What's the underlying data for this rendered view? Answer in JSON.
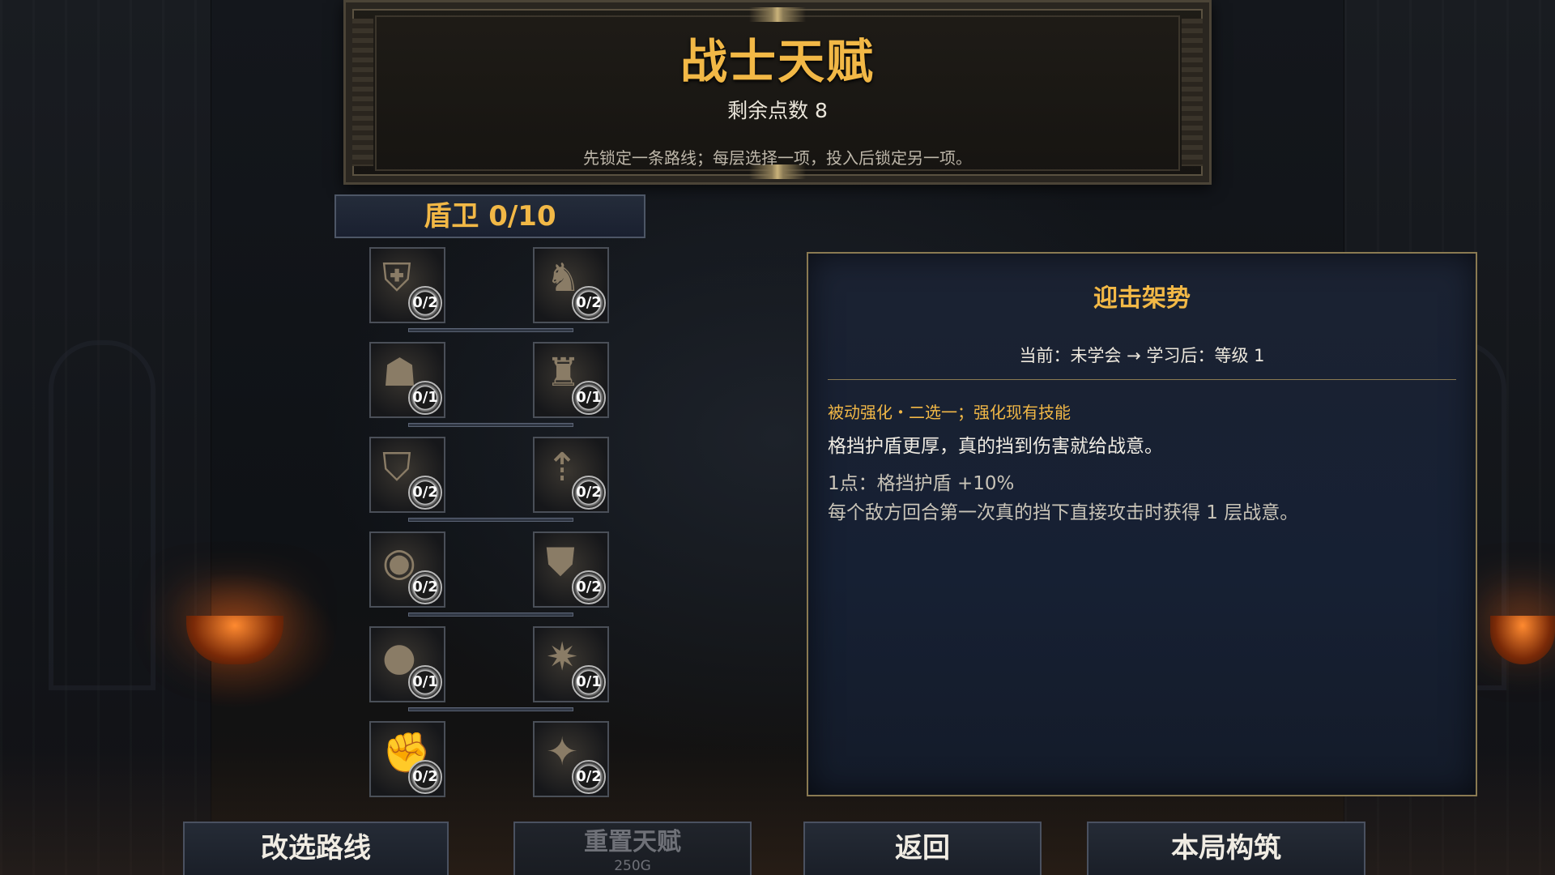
{
  "header": {
    "title": "战士天赋",
    "points": "剩余点数 8",
    "hint": "先锁定一条路线；每层选择一项，投入后锁定另一项。"
  },
  "branch": {
    "title": "盾卫 0/10",
    "rows": [
      {
        "left": {
          "icon": "shield-bash-icon",
          "glyph": "⛨",
          "rank": "0/2"
        },
        "right": {
          "icon": "iron-boots-icon",
          "glyph": "♞",
          "rank": "0/2"
        }
      },
      {
        "left": {
          "icon": "helmet-spark-icon",
          "glyph": "☗",
          "rank": "0/1"
        },
        "right": {
          "icon": "knight-emblem-icon",
          "glyph": "♜",
          "rank": "0/1"
        }
      },
      {
        "left": {
          "icon": "layered-shield-icon",
          "glyph": "⛉",
          "rank": "0/2"
        },
        "right": {
          "icon": "arrow-shield-icon",
          "glyph": "⇡",
          "rank": "0/2"
        }
      },
      {
        "left": {
          "icon": "round-shield-icon",
          "glyph": "◉",
          "rank": "0/2"
        },
        "right": {
          "icon": "armored-crest-icon",
          "glyph": "⛊",
          "rank": "0/2"
        }
      },
      {
        "left": {
          "icon": "dark-helm-icon",
          "glyph": "●",
          "rank": "0/1"
        },
        "right": {
          "icon": "war-horn-icon",
          "glyph": "✷",
          "rank": "0/1"
        }
      },
      {
        "left": {
          "icon": "gauntlet-sword-icon",
          "glyph": "✊",
          "rank": "0/2"
        },
        "right": {
          "icon": "blood-shield-icon",
          "glyph": "✦",
          "rank": "0/2"
        }
      }
    ]
  },
  "detail": {
    "name": "迎击架势",
    "state": "当前：未学会 → 学习后：等级 1",
    "tag": "被动强化・二选一；强化现有技能",
    "description": "格挡护盾更厚，真的挡到伤害就给战意。",
    "rank_line": "1点：格挡护盾 +10%",
    "effect_line": "每个敌方回合第一次真的挡下直接攻击时获得 1 层战意。"
  },
  "buttons": {
    "change_route": "改选路线",
    "reset": "重置天赋",
    "reset_cost": "250G",
    "back": "返回",
    "build": "本局构筑"
  },
  "colors": {
    "accent_gold": "#f2b846",
    "panel_border": "#8a7a52",
    "panel_bg": "#1b2232"
  }
}
